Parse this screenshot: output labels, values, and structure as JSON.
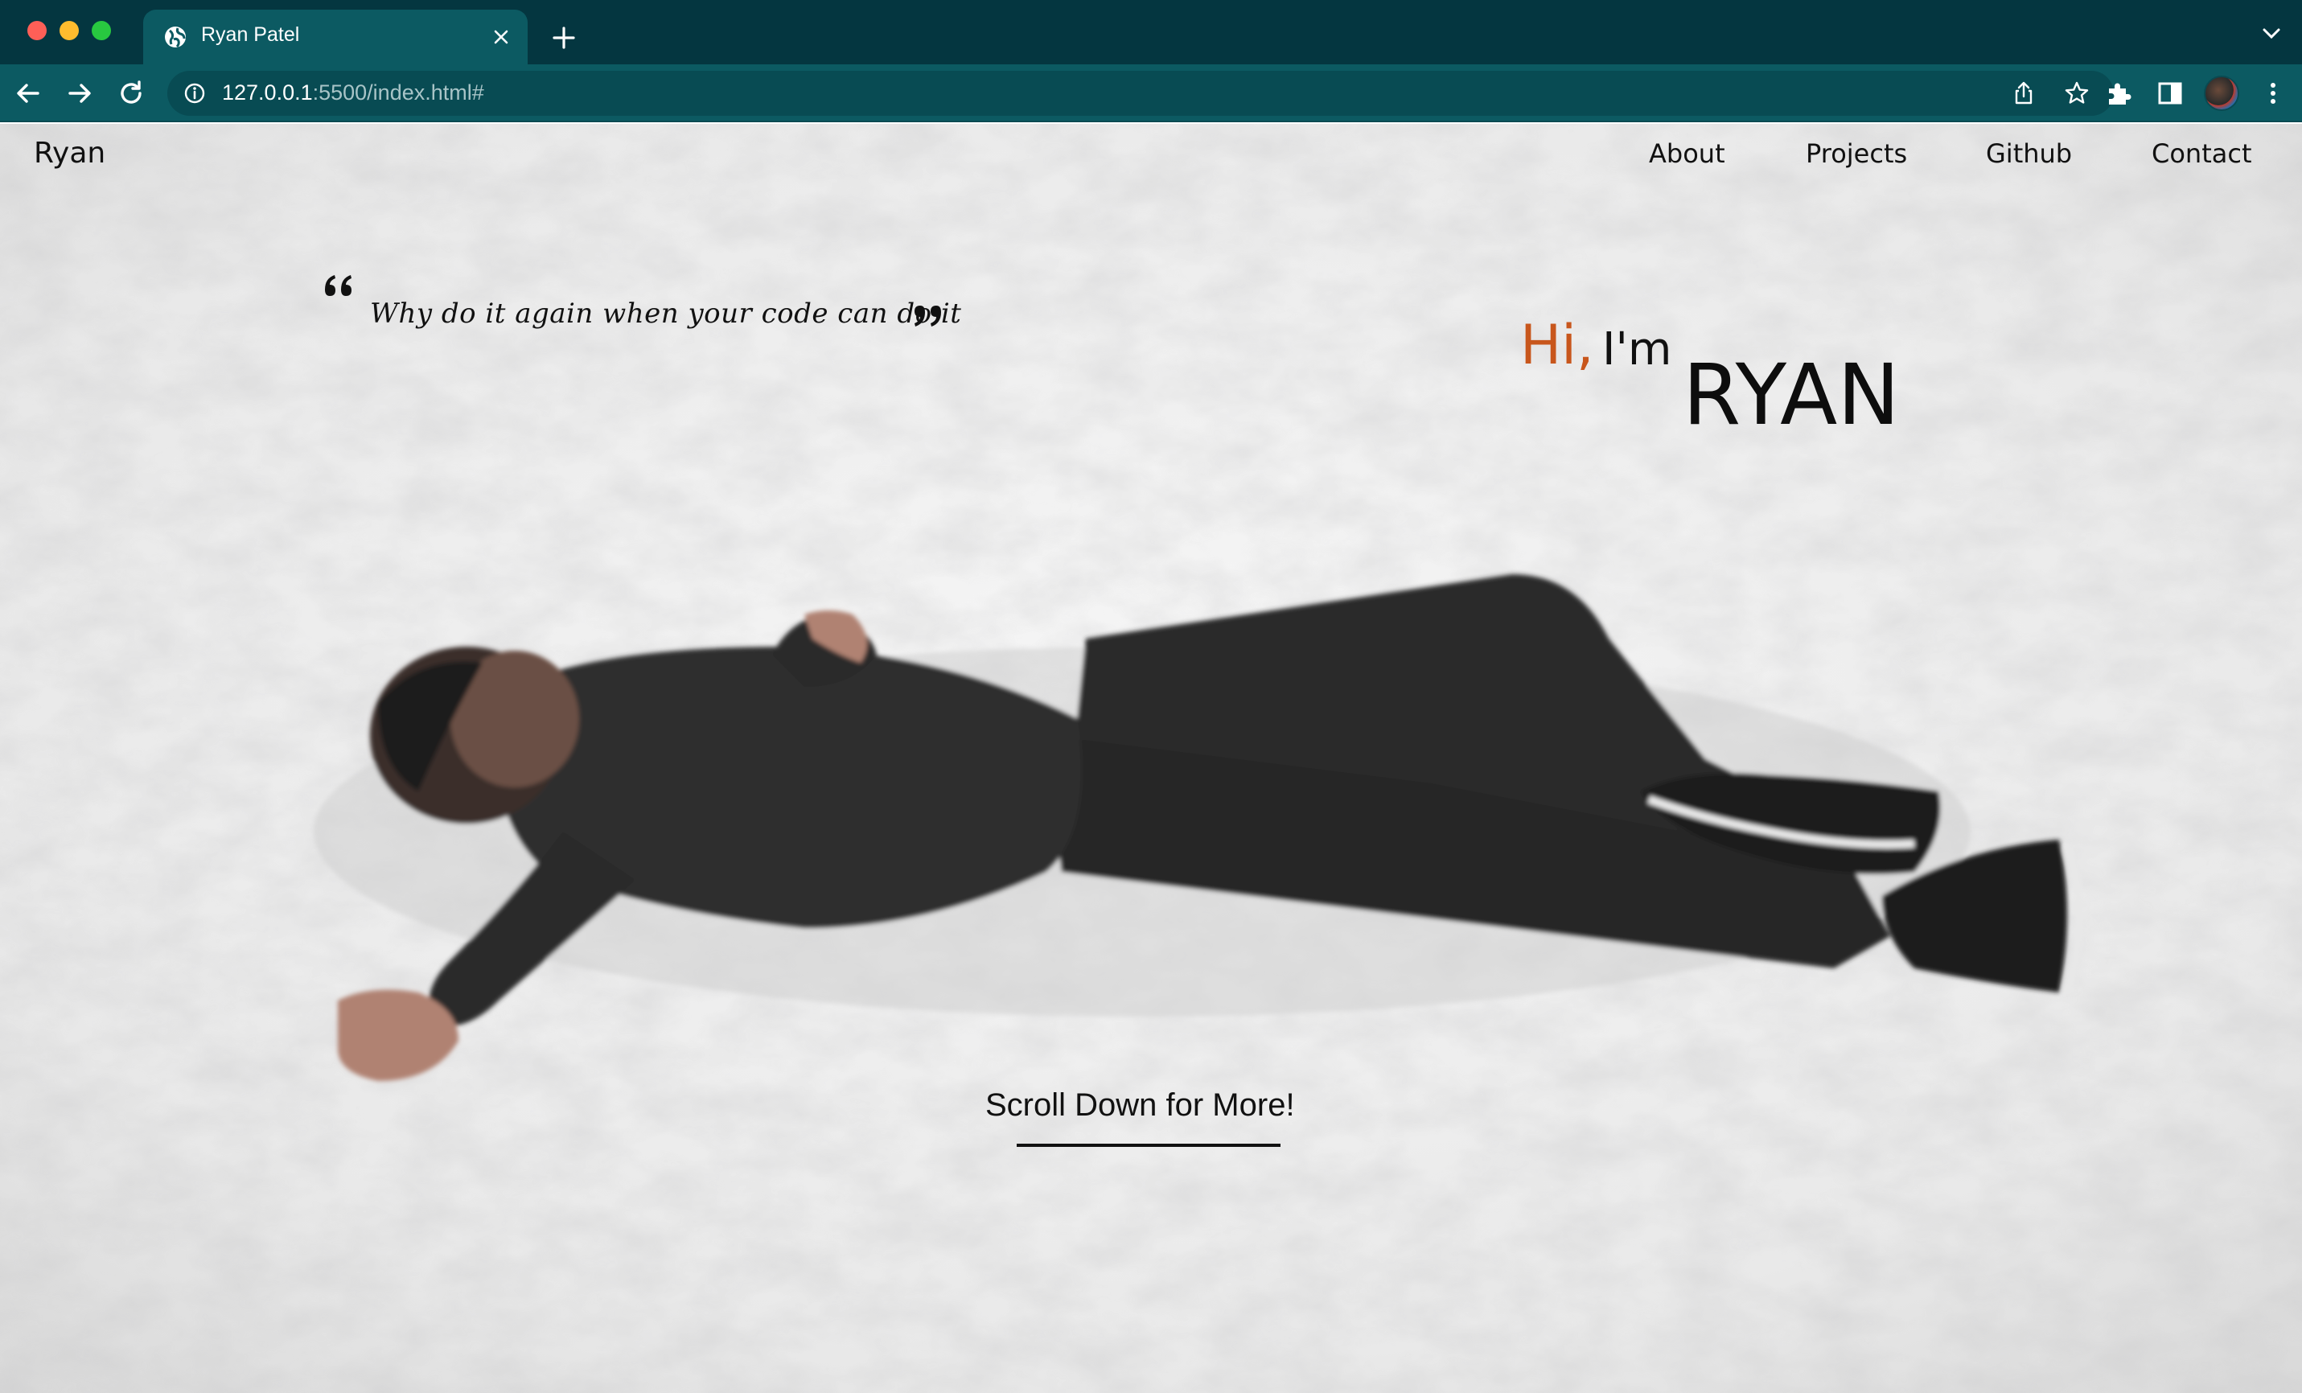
{
  "browser": {
    "tab_title": "Ryan Patel",
    "url_host": "127.0.0.1",
    "url_rest": ":5500/index.html#"
  },
  "nav": {
    "brand": "Ryan",
    "links": [
      "About",
      "Projects",
      "Github",
      "Contact"
    ]
  },
  "hero": {
    "quote": "Why do it again when your code can do it",
    "greeting": "Hi,",
    "intro": "I'm",
    "name": "RYAN",
    "accent_color": "#c8561c"
  },
  "cta": {
    "label": "Scroll Down for More!"
  },
  "icons": {
    "tab": "globe-icon",
    "close": "close-icon",
    "new_tab": "plus-icon",
    "back": "back-arrow-icon",
    "forward": "forward-arrow-icon",
    "reload": "reload-icon",
    "info": "info-icon",
    "share": "share-icon",
    "bookmark": "star-icon",
    "extensions": "puzzle-icon",
    "side_panel": "side-panel-icon",
    "menu": "kebab-menu-icon"
  }
}
